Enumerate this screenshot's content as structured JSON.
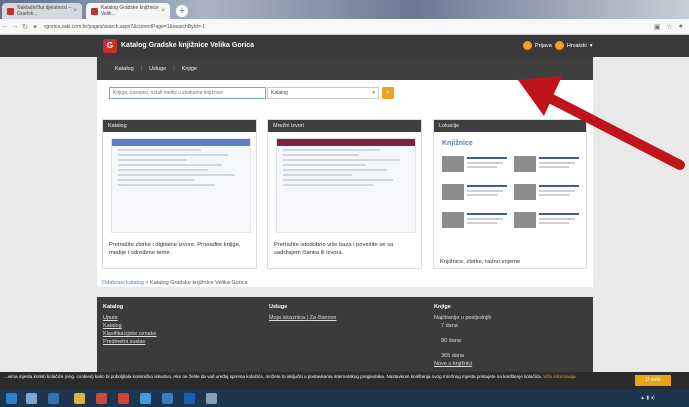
{
  "browser": {
    "tab1_title": "Nakladnička djelatnost – Gradsk...",
    "tab2_title": "Katalog Gradske knjižnice Velik...",
    "url": "vgorica.zaki.com.hr/pages/search.aspx?&currentPage=1&searchById=-1"
  },
  "header": {
    "logo_text": "G",
    "title": "Katalog Gradske knjižnice Velika Gorica",
    "login": "Prijava",
    "language": "Hrvatski"
  },
  "menu": {
    "items": [
      "Katalog",
      "Usluge",
      "Knjige"
    ]
  },
  "search": {
    "placeholder": "Knjiga, časopisi, ostali mediji u zbirkama knjižnice",
    "select_value": "Katalog"
  },
  "cards": [
    {
      "header": "Katalog",
      "description": "Pretražite zbirke i digitalne izvore. Pronađite knjige, medije i određene teme."
    },
    {
      "header": "Mrežni izvori",
      "description": "Pretražite istodobno više baza i povežite se sa sadržajem članka ili izvora."
    },
    {
      "header": "Lokacije",
      "title": "Knjižnice",
      "description": "Knjižnice, zbirke, radno vrijeme"
    }
  ],
  "breadcrumb": {
    "link": "Odabrani katalog",
    "rest": "» Katalog Gradske knjižnice Velika Gorica"
  },
  "footer": {
    "col1": {
      "title": "Katalog",
      "items": [
        "Upute",
        "Katalog",
        "Klasifikacijske oznake",
        "Predmetni sustav"
      ]
    },
    "col2": {
      "title": "Usluge",
      "items": [
        "Moja iskaznica",
        "Za članove"
      ]
    },
    "col3": {
      "title": "Knjige",
      "items": [
        "Najčitanije u posljednjih",
        "7 dana",
        "90 dana",
        "365 dana",
        "Nove u knjižnici"
      ]
    }
  },
  "cookie": {
    "text": "...vima mjesta koristi kolačiće (eng. cookies) kako bi poboljšala korisničko iskustvo. Ako ne želite da vaš uređaj sprema kolačiće, možete to isključiti u postavkama internetskog preglednika. Nastavkom korištenja ovog mrežnog mjesta pristajete na korištenje kolačića.",
    "link": "Više informacija",
    "button": "U redu"
  },
  "colors": {
    "accent": "#f0a21b",
    "header_dark": "#3a3a3a",
    "link_blue": "#5b7fc2",
    "annotation_arrow": "#c0141a"
  }
}
